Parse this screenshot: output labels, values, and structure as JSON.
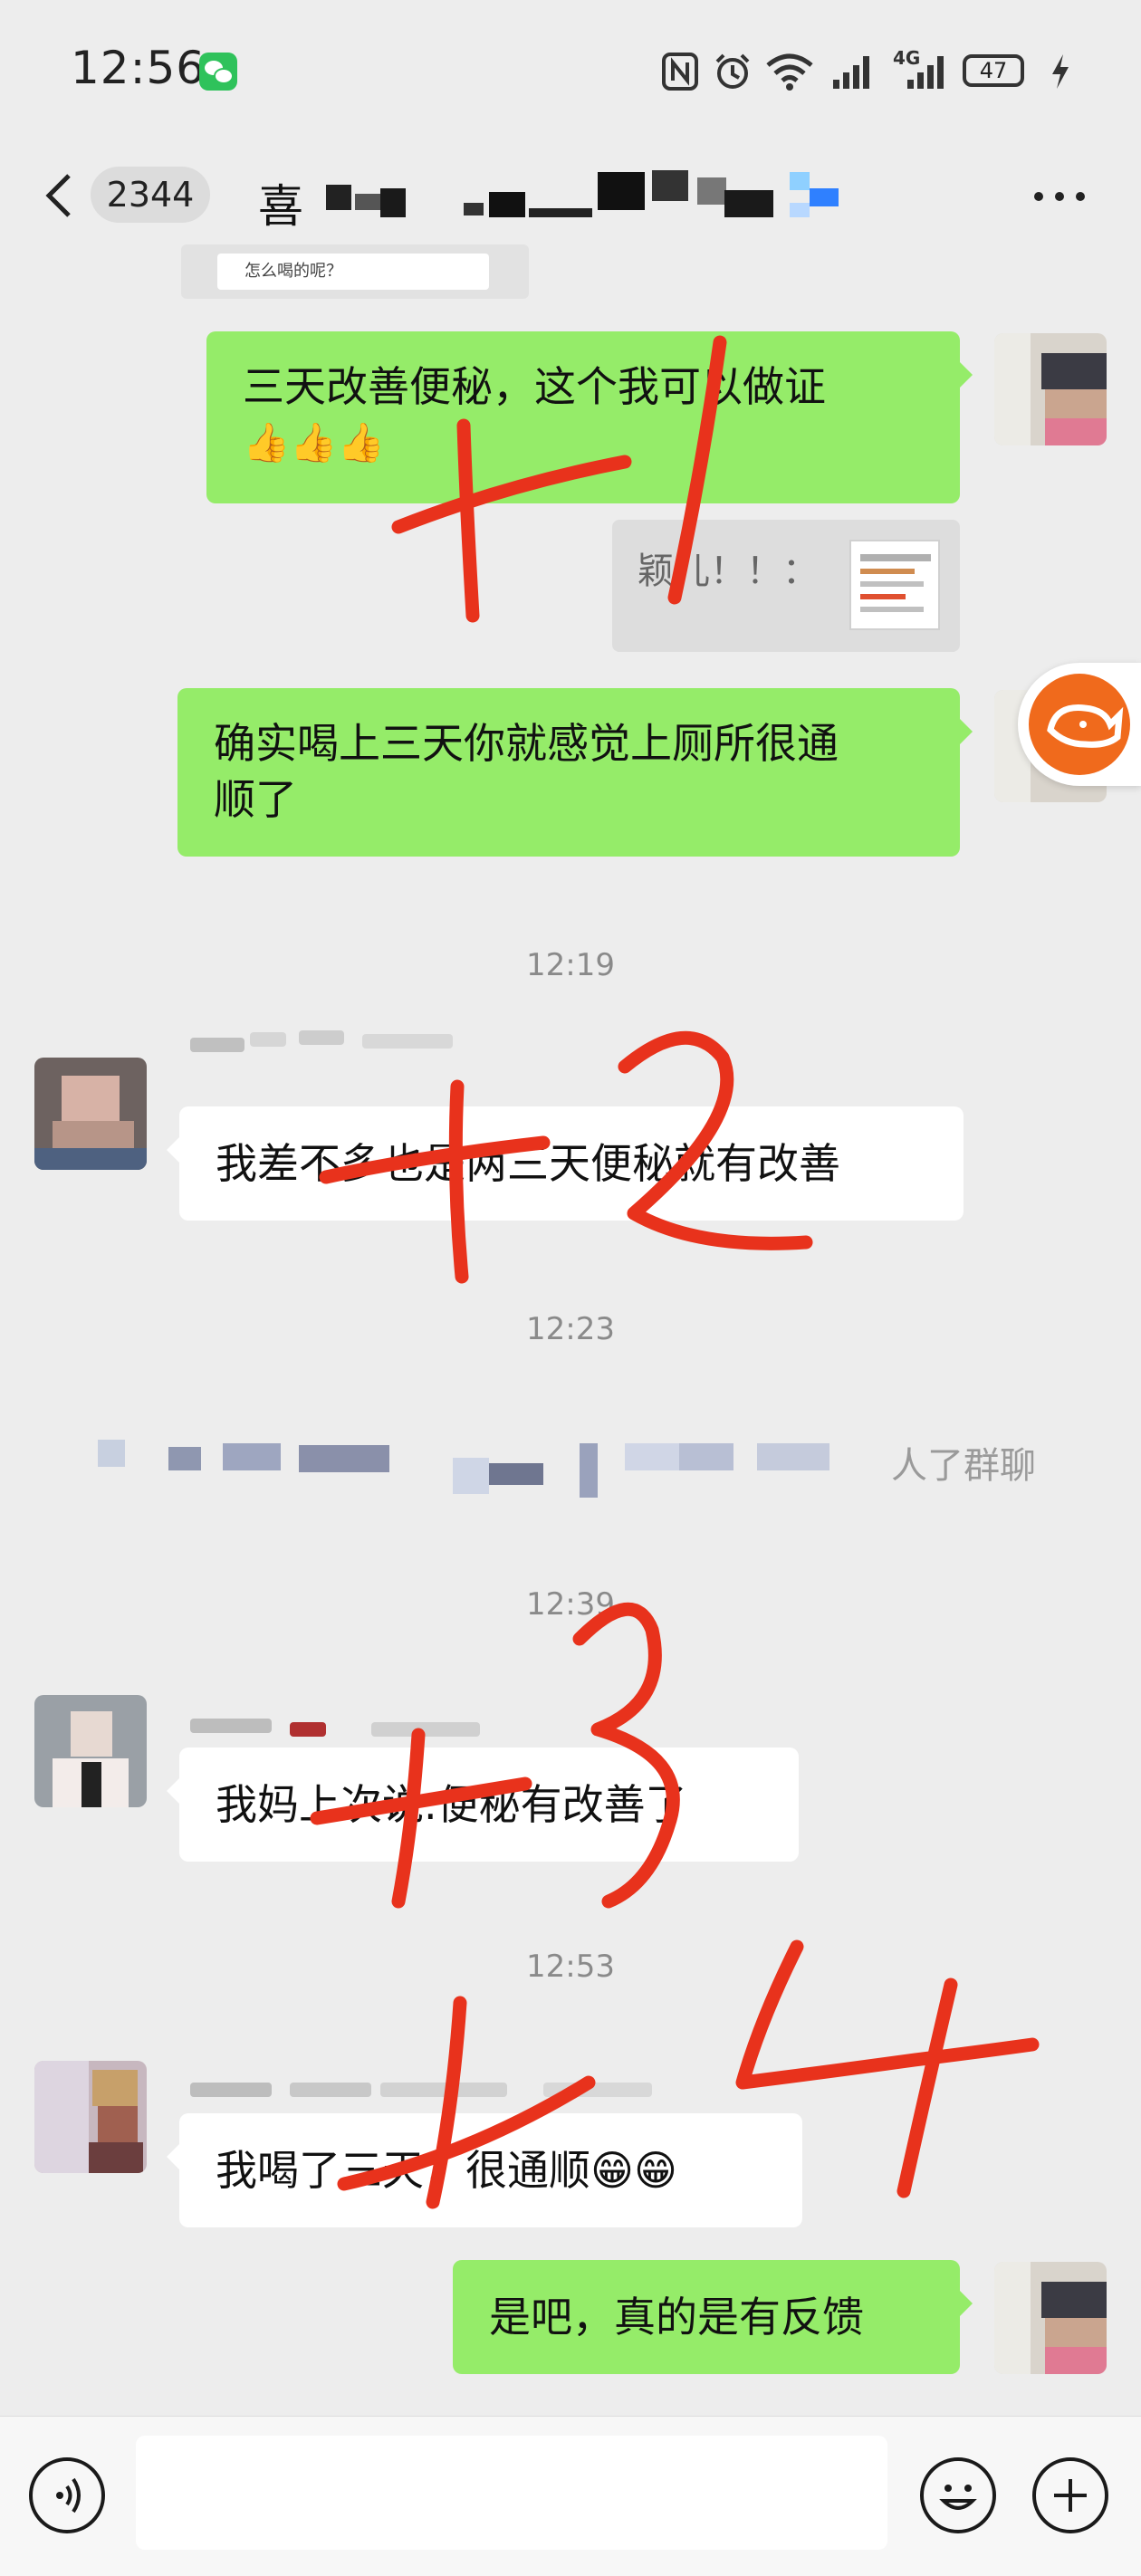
{
  "status_bar": {
    "time": "12:56",
    "network": "4G",
    "battery": "47"
  },
  "nav": {
    "unread_count": "2344",
    "title_visible": "喜"
  },
  "quoted_message": {
    "text": "怎么喝的呢？"
  },
  "messages": [
    {
      "side": "me",
      "text": "三天改善便秘，这个我可以做证",
      "emoji": "👍👍👍"
    },
    {
      "side": "me-quote",
      "text": "颖儿！！："
    },
    {
      "side": "me",
      "text_line1": "确实喝上三天你就感觉上厕所很通",
      "text_line2": "顺了"
    },
    {
      "side": "other",
      "text": "我差不多也是两三天便秘就有改善"
    },
    {
      "side": "other",
      "text": "我妈上次说.便秘有改善了"
    },
    {
      "side": "other",
      "text": "我喝了三天，很通顺😁😁"
    },
    {
      "side": "me",
      "text": "是吧，真的是有反馈"
    }
  ],
  "timestamps": [
    "12:19",
    "12:23",
    "12:39",
    "12:53"
  ],
  "system_notice": {
    "visible_text": "人了群聊"
  },
  "annotations": [
    "+1",
    "+2",
    "+3",
    "+4"
  ],
  "icons": {
    "back": "chevron-left-icon",
    "more": "more-dots-icon",
    "voice": "voice-icon",
    "emoji": "emoji-icon",
    "plus": "plus-icon"
  },
  "colors": {
    "my_bubble": "#95ec69",
    "other_bubble": "#ffffff",
    "background": "#ededed",
    "annotation_red": "#e8321c"
  }
}
